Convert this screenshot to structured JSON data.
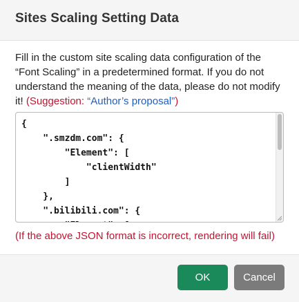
{
  "dialog": {
    "title": "Sites Scaling Setting Data",
    "description_main": "Fill in the custom site scaling data configuration of the “Font Scaling” in a predetermined format. If you do not understand the meaning of the data, please do not modify it!",
    "suggestion_prefix": "(Suggestion: ",
    "suggestion_link": "“Author’s proposal”",
    "suggestion_suffix": ")",
    "json_value": "{\n    \".smzdm.com\": {\n        \"Element\": [\n            \"clientWidth\"\n        ]\n    },\n    \".bilibili.com\": {\n        \"Element\": [\n            \"clientWidth\"\n        ]\n    }\n}",
    "error_note": "(If the above JSON format is incorrect, rendering will fail)",
    "ok_label": "OK",
    "cancel_label": "Cancel"
  },
  "colors": {
    "accent_ok": "#1a8a5a",
    "cancel": "#7b7b7b",
    "warning_text": "#c0152f",
    "link": "#1f5fbf"
  }
}
